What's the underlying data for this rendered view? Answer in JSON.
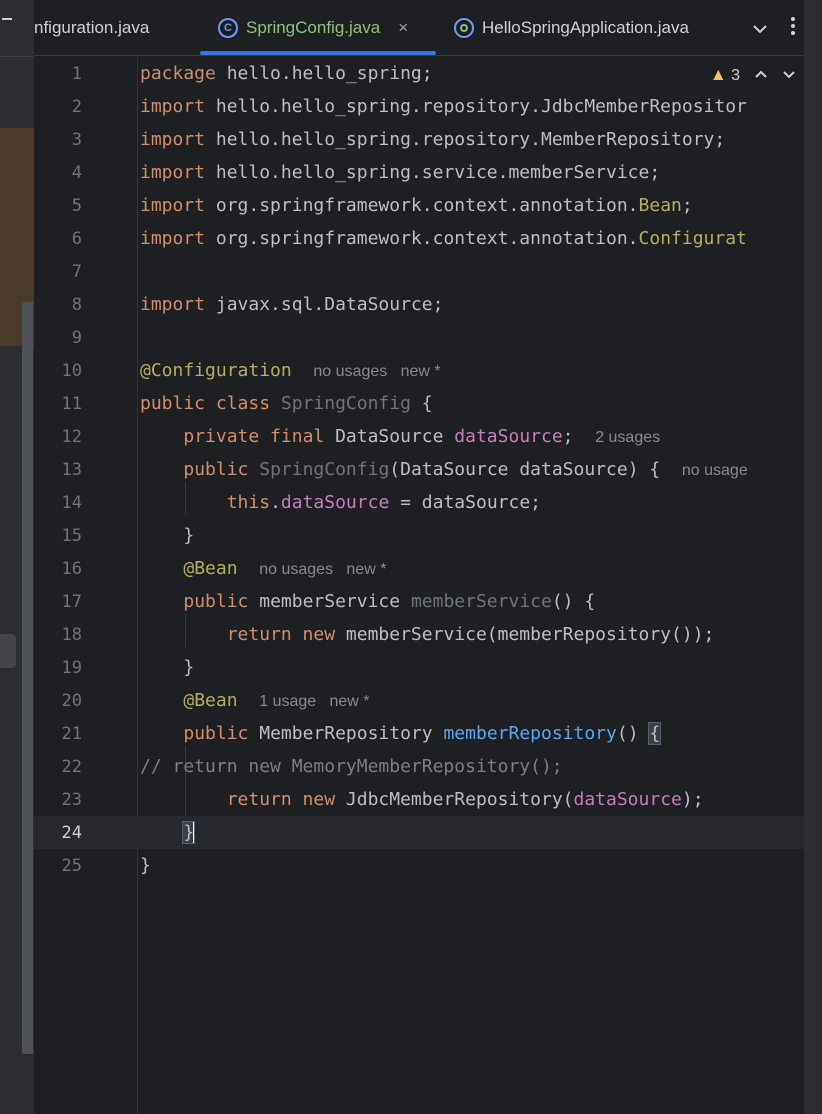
{
  "tabs": [
    {
      "label": "nfiguration.java",
      "active": false,
      "closable": false,
      "icon": ""
    },
    {
      "label": "SpringConfig.java",
      "active": true,
      "closable": true,
      "icon": "class-c-icon"
    },
    {
      "label": "HelloSpringApplication.java",
      "active": false,
      "closable": false,
      "icon": "spring-boot-class-icon"
    }
  ],
  "tab_tools": {
    "more_tabs_icon": "chevron-down-icon",
    "menu_icon": "vertical-ellipsis-icon"
  },
  "tab_icon_glyph": "C",
  "close_glyph": "×",
  "inspections": {
    "warning_count": "3",
    "warning_icon": "warning-triangle-icon",
    "prev_icon": "chevron-up-icon",
    "next_icon": "chevron-down-icon"
  },
  "colors": {
    "accent_tab": "#3574f0",
    "keyword": "#cf8e6d",
    "annotation": "#b3ae60",
    "field": "#c77dbb",
    "method_decl": "#56a8f5",
    "active_tab_text": "#8fc17f",
    "warning": "#f2c55c"
  },
  "editor": {
    "current_line": 24,
    "lines": [
      {
        "n": "1",
        "segs": [
          [
            "kw",
            "package"
          ],
          [
            "",
            " hello.hello_spring;"
          ]
        ]
      },
      {
        "n": "2",
        "segs": [
          [
            "kw",
            "import"
          ],
          [
            "",
            " hello.hello_spring.repository.JdbcMemberRepositor"
          ]
        ]
      },
      {
        "n": "3",
        "segs": [
          [
            "kw",
            "import"
          ],
          [
            "",
            " hello.hello_spring.repository.MemberRepository;"
          ]
        ]
      },
      {
        "n": "4",
        "segs": [
          [
            "kw",
            "import"
          ],
          [
            "",
            " hello.hello_spring.service.memberService;"
          ]
        ]
      },
      {
        "n": "5",
        "segs": [
          [
            "kw",
            "import"
          ],
          [
            "",
            " org.springframework.context.annotation."
          ],
          [
            "ann",
            "Bean"
          ],
          [
            "",
            ";"
          ]
        ]
      },
      {
        "n": "6",
        "segs": [
          [
            "kw",
            "import"
          ],
          [
            "",
            " org.springframework.context.annotation."
          ],
          [
            "ann",
            "Configurat"
          ]
        ]
      },
      {
        "n": "7",
        "segs": []
      },
      {
        "n": "8",
        "segs": [
          [
            "kw",
            "import"
          ],
          [
            "",
            " javax.sql.DataSource;"
          ]
        ]
      },
      {
        "n": "9",
        "segs": []
      },
      {
        "n": "10",
        "segs": [
          [
            "ann",
            "@Configuration"
          ],
          [
            "",
            "  "
          ],
          [
            "hint",
            "no usages   new *"
          ]
        ]
      },
      {
        "n": "11",
        "segs": [
          [
            "kw",
            "public class"
          ],
          [
            "",
            " "
          ],
          [
            "dim",
            "SpringConfig"
          ],
          [
            "",
            " {"
          ]
        ]
      },
      {
        "n": "12",
        "segs": [
          [
            "",
            "    "
          ],
          [
            "kw",
            "private final"
          ],
          [
            "",
            " DataSource "
          ],
          [
            "field",
            "dataSource"
          ],
          [
            "",
            ";  "
          ],
          [
            "hint",
            "2 usages"
          ]
        ]
      },
      {
        "n": "13",
        "segs": [
          [
            "",
            "    "
          ],
          [
            "kw",
            "public"
          ],
          [
            "",
            " "
          ],
          [
            "dim",
            "SpringConfig"
          ],
          [
            "",
            "(DataSource dataSource) {  "
          ],
          [
            "hint",
            "no usage"
          ]
        ]
      },
      {
        "n": "14",
        "segs": [
          [
            "",
            "        "
          ],
          [
            "kw",
            "this"
          ],
          [
            "",
            "."
          ],
          [
            "field",
            "dataSource"
          ],
          [
            "",
            " = dataSource;"
          ]
        ]
      },
      {
        "n": "15",
        "segs": [
          [
            "",
            "    }"
          ]
        ]
      },
      {
        "n": "16",
        "segs": [
          [
            "",
            "    "
          ],
          [
            "ann",
            "@Bean"
          ],
          [
            "",
            "  "
          ],
          [
            "hint",
            "no usages   new *"
          ]
        ]
      },
      {
        "n": "17",
        "segs": [
          [
            "",
            "    "
          ],
          [
            "kw",
            "public"
          ],
          [
            "",
            " memberService "
          ],
          [
            "dim",
            "memberService"
          ],
          [
            "",
            "() {"
          ]
        ]
      },
      {
        "n": "18",
        "segs": [
          [
            "",
            "        "
          ],
          [
            "kw",
            "return new"
          ],
          [
            "",
            " memberService(memberRepository());"
          ]
        ]
      },
      {
        "n": "19",
        "segs": [
          [
            "",
            "    }"
          ]
        ]
      },
      {
        "n": "20",
        "segs": [
          [
            "",
            "    "
          ],
          [
            "ann",
            "@Bean"
          ],
          [
            "",
            "  "
          ],
          [
            "hint",
            "1 usage   new *"
          ]
        ]
      },
      {
        "n": "21",
        "segs": [
          [
            "",
            "    "
          ],
          [
            "kw",
            "public"
          ],
          [
            "",
            " MemberRepository "
          ],
          [
            "mdecl",
            "memberRepository"
          ],
          [
            "",
            "() "
          ],
          [
            "brace",
            "{"
          ]
        ]
      },
      {
        "n": "22",
        "segs": [
          [
            "comment",
            "// return new MemoryMemberRepository();"
          ]
        ]
      },
      {
        "n": "23",
        "segs": [
          [
            "",
            "        "
          ],
          [
            "kw",
            "return new"
          ],
          [
            "",
            " JdbcMemberRepository("
          ],
          [
            "field",
            "dataSource"
          ],
          [
            "",
            ");"
          ]
        ]
      },
      {
        "n": "24",
        "segs": [
          [
            "",
            "    "
          ],
          [
            "brace",
            "}"
          ],
          [
            "caret",
            ""
          ]
        ]
      },
      {
        "n": "25",
        "segs": [
          [
            "",
            "}"
          ]
        ]
      }
    ]
  }
}
